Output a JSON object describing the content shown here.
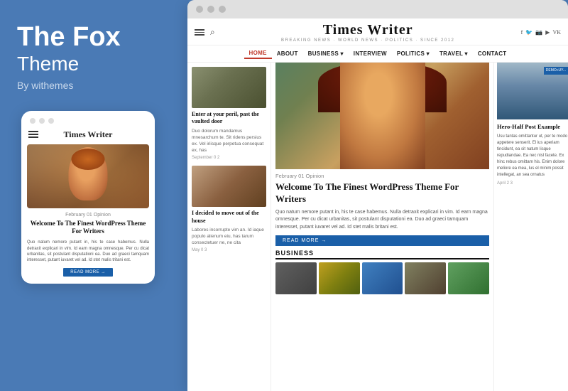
{
  "leftPanel": {
    "brandTitle": "The Fox",
    "brandSubtitle": "Theme",
    "brandBy": "By withemes"
  },
  "mobile": {
    "siteTitle": "Times Writer",
    "dateLine": "February 01   Opinion",
    "articleTitle": "Welcome To The Finest WordPress Theme For Writers",
    "articleBody": "Quo natum nemore putant in, his te case habemus. Nulla detraxit explicari in vim. Id earn magna omnesque. Per cu dicat urbanitas, sit postulant disputationi ea. Duo ad graeci tamquam interesset, putant iuvaret vel ad. Id stet malis tritani est.",
    "readMore": "READ MORE →"
  },
  "desktop": {
    "siteTitle": "Times Writer",
    "tagline": "BREAKING NEWS · WORLD NEWS · POLITICS · SINCE 2012",
    "nav": [
      "HOME",
      "ABOUT",
      "BUSINESS ▾",
      "INTERVIEW",
      "POLITICS ▾",
      "TRAVEL ▾",
      "CONTACT"
    ],
    "leftArticles": [
      {
        "title": "Enter at your peril, past the vaulted door",
        "body": "Duo dolorum mandamus mnesarchum te. Sit ridens persius ex. Vel iriisque perpetua consequat ex, has",
        "date": "September 0 2"
      },
      {
        "title": "I decided to move out of the house",
        "body": "Labores incorrupte vim an. Id iaque populo alienum eiu, has tarum consectetuer ne, ne cita",
        "date": "May 0 3"
      }
    ],
    "featuredDateLine": "February 01   Opinion",
    "featuredTitle": "Welcome To The Finest WordPress Theme For Writers",
    "featuredBody": "Quo natum nemore putant in, his te case habemus. Nulla detraxit explicari in vim. Id earn magna omnesque. Per cu dicat urbanitas, sit postulant disputationi ea. Duo ad graeci tamquam interesset, putant iuvaret vel ad. Id stet malis britani est.",
    "readMoreBtn": "READ MORE →",
    "businessSection": "BUSINESS",
    "rightArticle": {
      "title": "Hero-Half Post Example",
      "body": "Usu tantas omittantur ut, per te modo appetere senserit. El ius aperiam tincidunt, ea sit natum lisque repudiandae. Ea nec nisl facete. Ex hinc rebus omittam his. Enim dolore meliore ea mea, lus el minim possit intellegat, an sea ornatus",
      "date": "April 2 3"
    },
    "social": [
      "f",
      "🐦",
      "in",
      "▶",
      "vk"
    ]
  }
}
